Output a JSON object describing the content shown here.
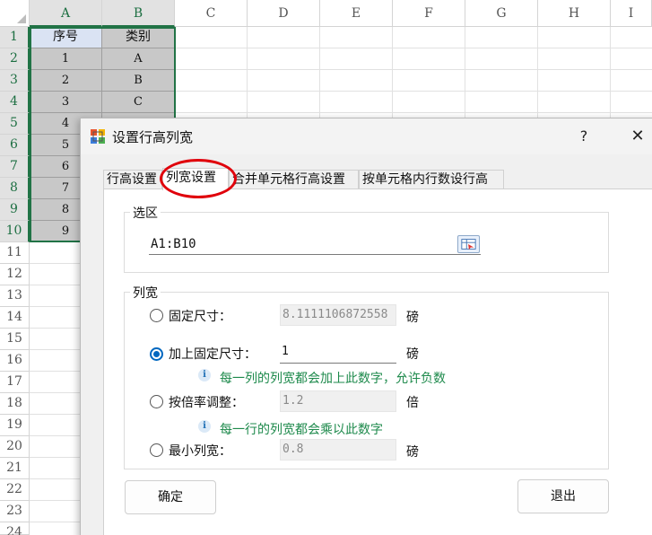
{
  "sheet": {
    "columns": [
      "A",
      "B",
      "C",
      "D",
      "E",
      "F",
      "G",
      "H",
      "I"
    ],
    "rows": [
      "1",
      "2",
      "3",
      "4",
      "5",
      "6",
      "7",
      "8",
      "9",
      "10",
      "11",
      "12",
      "13",
      "14",
      "15",
      "16",
      "17",
      "18",
      "19",
      "20",
      "21",
      "22",
      "23",
      "24"
    ],
    "header_cells": {
      "a1": "序号",
      "b1": "类别"
    },
    "data_rows": [
      {
        "a": "1",
        "b": "A"
      },
      {
        "a": "2",
        "b": "B"
      },
      {
        "a": "3",
        "b": "C"
      },
      {
        "a": "4",
        "b": ""
      },
      {
        "a": "5",
        "b": ""
      },
      {
        "a": "6",
        "b": ""
      },
      {
        "a": "7",
        "b": ""
      },
      {
        "a": "8",
        "b": ""
      },
      {
        "a": "9",
        "b": ""
      }
    ],
    "selection_color": "#217346"
  },
  "dialog": {
    "title": "设置行高列宽",
    "help": "?",
    "close": "✕",
    "tabs": [
      "行高设置",
      "列宽设置",
      "合并单元格行高设置",
      "按单元格内行数设行高"
    ],
    "active_tab": "列宽设置",
    "selection_group": {
      "legend": "选区",
      "range_value": "A1:B10",
      "picker_icon": "range-select-icon"
    },
    "width_group": {
      "legend": "列宽",
      "options": [
        {
          "label": "固定尺寸：",
          "value": "8.1111106872558",
          "unit": "磅",
          "checked": false
        },
        {
          "label": "加上固定尺寸：",
          "value": "1",
          "unit": "磅",
          "checked": true
        },
        {
          "label": "按倍率调整：",
          "value": "1.2",
          "unit": "倍",
          "checked": false
        },
        {
          "label": "最小列宽：",
          "value": "0.8",
          "unit": "磅",
          "checked": false
        }
      ],
      "hint_add": "每一列的列宽都会加上此数字，允许负数",
      "hint_multiply": "每一行的列宽都会乘以此数字"
    },
    "ok_label": "确定",
    "exit_label": "退出",
    "annotation_color": "#e0000b"
  }
}
